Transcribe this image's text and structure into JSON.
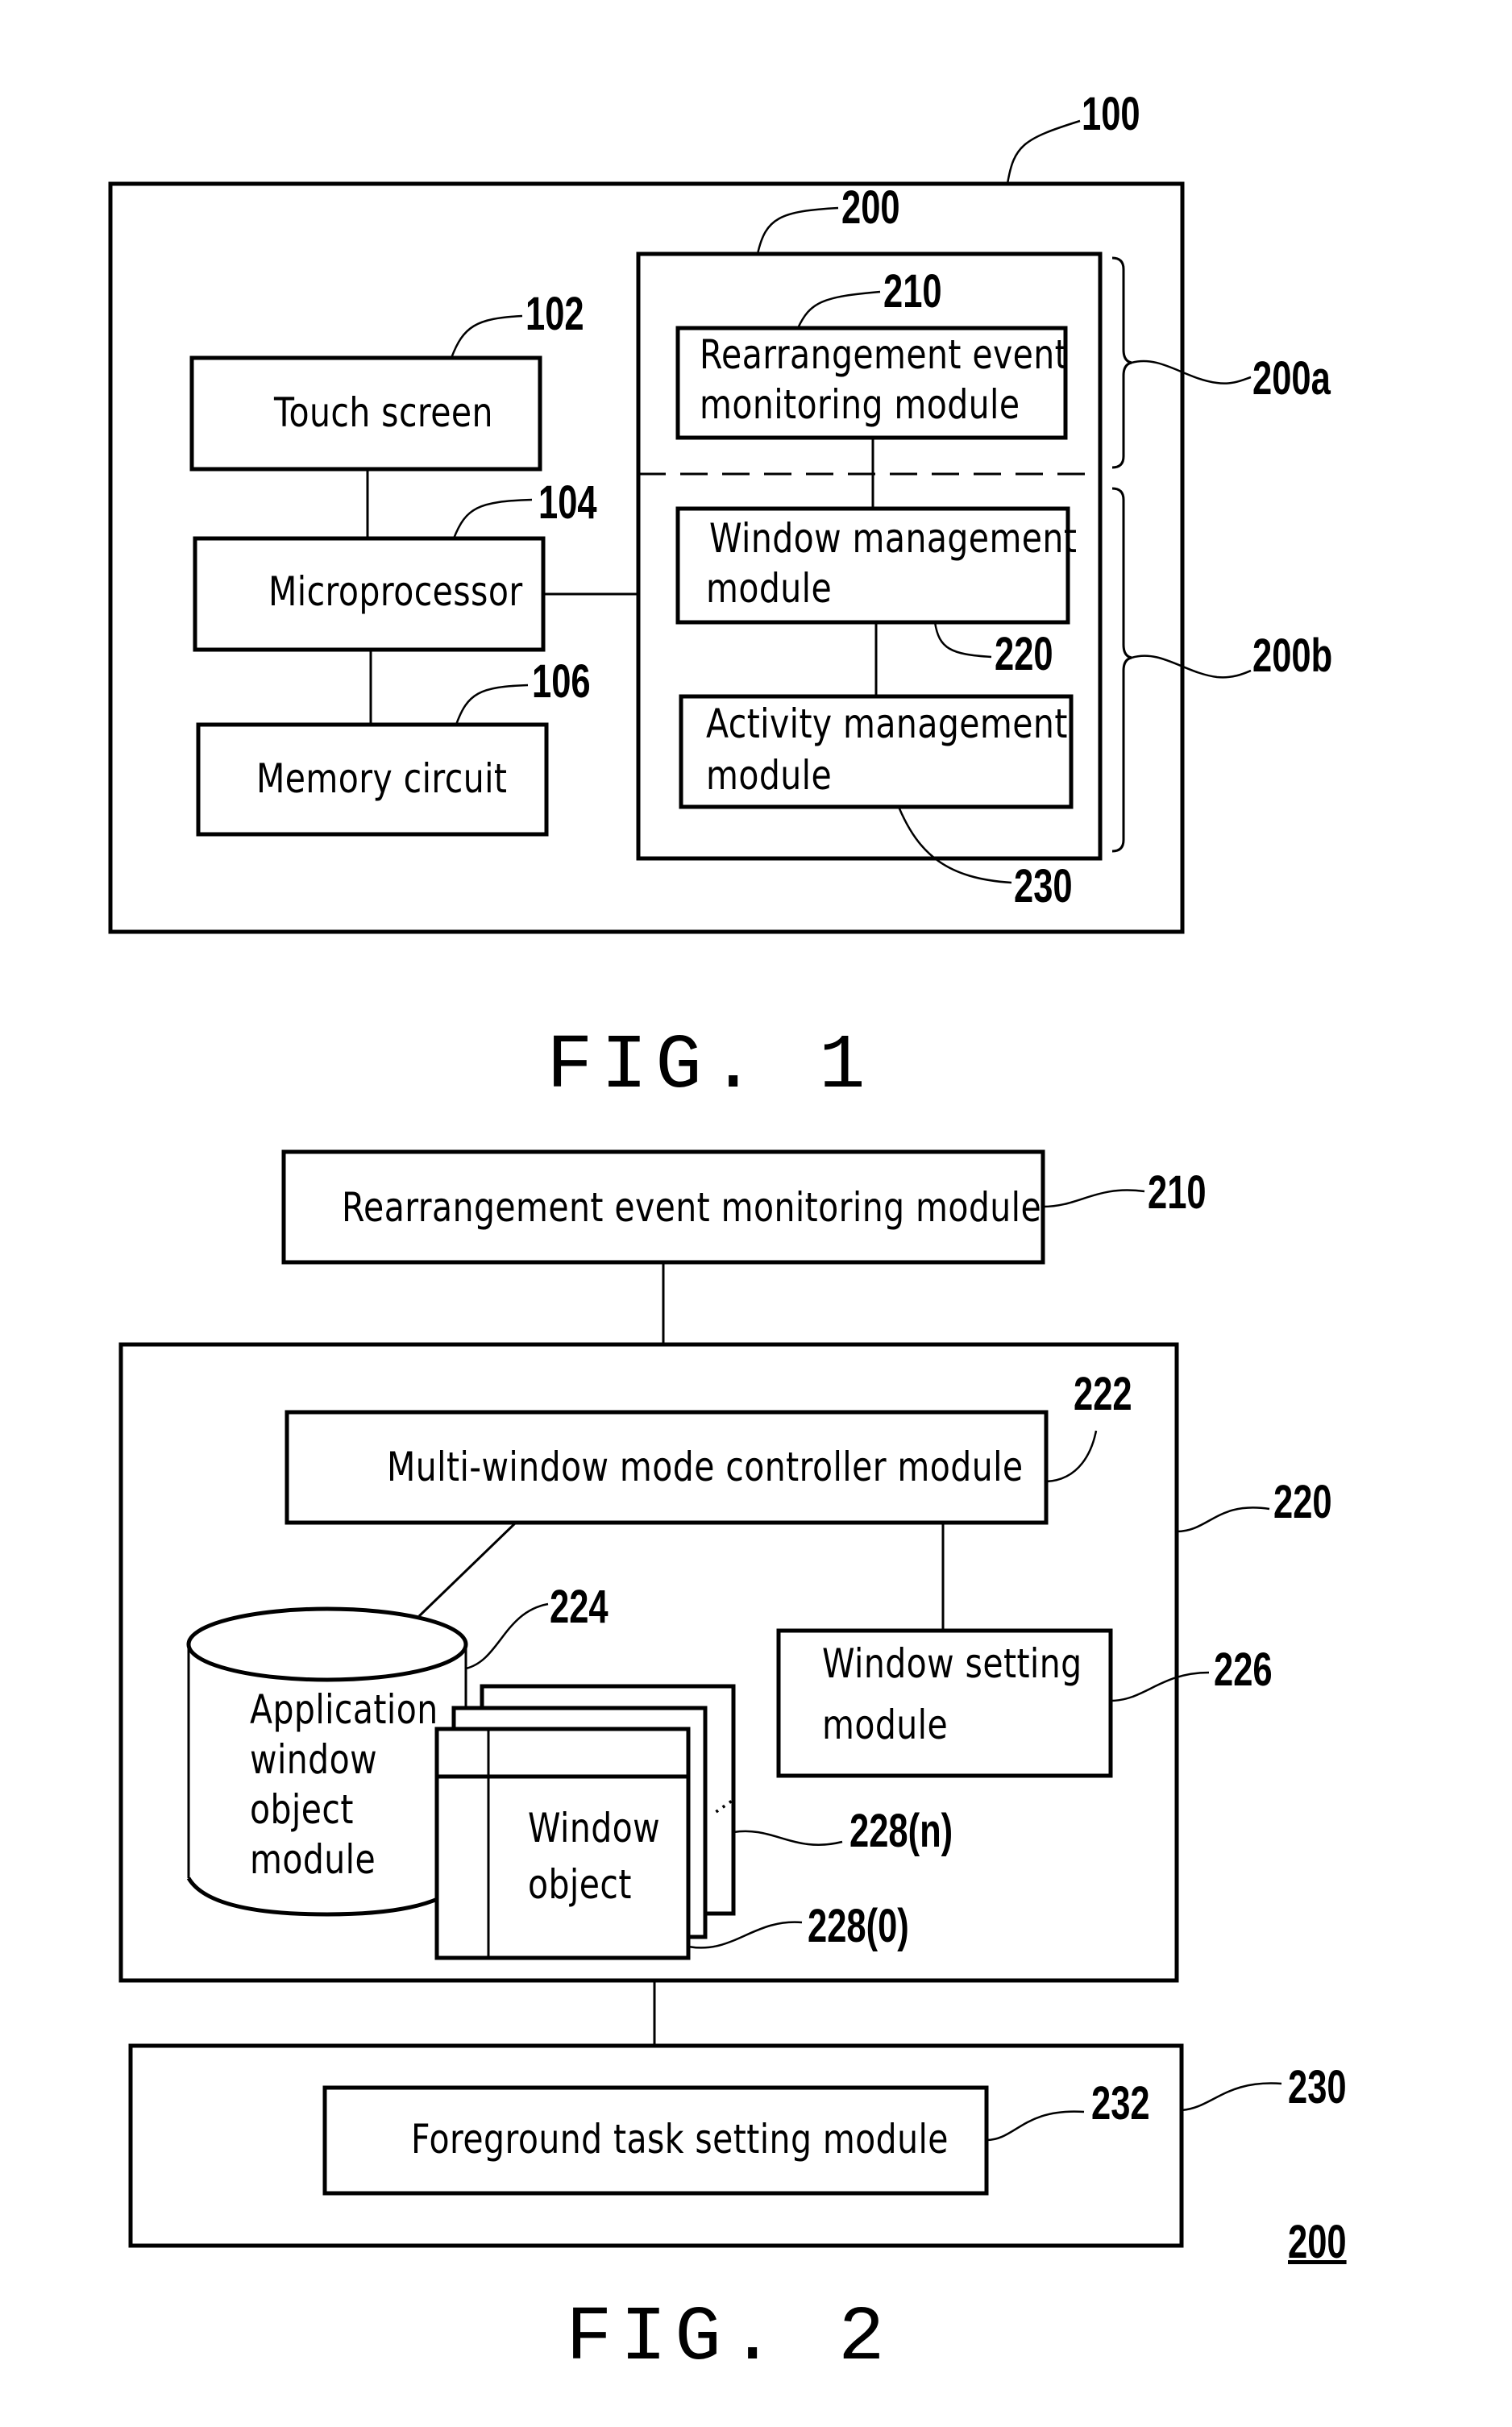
{
  "figure1": {
    "caption": "FIG. 1",
    "refs": {
      "device": "100",
      "touch_screen": "102",
      "microprocessor": "104",
      "memory_circuit": "106",
      "system": "200",
      "rearrangement": "210",
      "window_mgmt": "220",
      "activity_mgmt": "230",
      "group_a": "200a",
      "group_b": "200b"
    },
    "blocks": {
      "touch_screen": "Touch screen",
      "microprocessor": "Microprocessor",
      "memory_circuit": "Memory circuit",
      "rearrangement_l1": "Rearrangement event",
      "rearrangement_l2": "monitoring module",
      "window_mgmt_l1": "Window management",
      "window_mgmt_l2": "module",
      "activity_mgmt_l1": "Activity management",
      "activity_mgmt_l2": "module"
    }
  },
  "figure2": {
    "caption": "FIG. 2",
    "system_ref": "200",
    "refs": {
      "rearrangement": "210",
      "window_mgmt": "220",
      "multi_window": "222",
      "app_window_object": "224",
      "window_setting": "226",
      "window_object_n": "228(n)",
      "window_object_0": "228(0)",
      "activity_mgmt": "230",
      "foreground_task": "232"
    },
    "blocks": {
      "rearrangement": "Rearrangement event monitoring module",
      "multi_window": "Multi-window mode controller module",
      "app_window_object_lines": [
        "Application",
        "window",
        "object",
        "module"
      ],
      "window_setting_l1": "Window setting",
      "window_setting_l2": "module",
      "window_object_l1": "Window",
      "window_object_l2": "object",
      "ellipsis": "...",
      "foreground_task": "Foreground task setting module"
    }
  }
}
